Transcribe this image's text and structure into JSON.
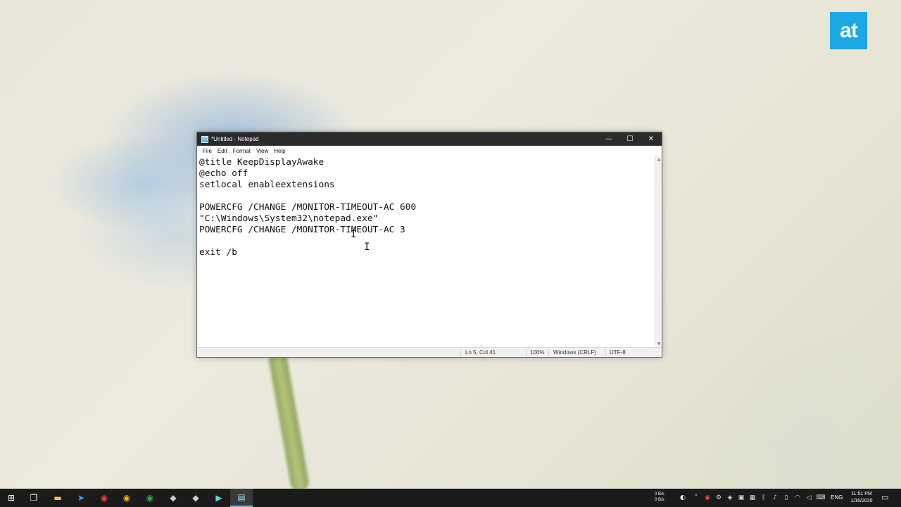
{
  "brand": {
    "logo_text": "at",
    "color": "#1ca8e4"
  },
  "notepad": {
    "title": "*Untitled - Notepad",
    "window_controls": {
      "minimize": "—",
      "maximize": "☐",
      "close": "✕"
    },
    "menu": [
      "File",
      "Edit",
      "Format",
      "View",
      "Help"
    ],
    "lines": [
      "@title KeepDisplayAwake",
      "@echo off",
      "setlocal enableextensions",
      "",
      "POWERCFG /CHANGE /MONITOR-TIMEOUT-AC 600",
      "\"C:\\Windows\\System32\\notepad.exe\"",
      "POWERCFG /CHANGE /MONITOR-TIMEOUT-AC 3",
      "",
      "exit /b"
    ],
    "status": {
      "position": "Ln 5, Col 41",
      "zoom": "100%",
      "line_ending": "Windows (CRLF)",
      "encoding": "UTF-8"
    }
  },
  "taskbar": {
    "pinned": [
      {
        "name": "start-icon",
        "glyph": "⊞"
      },
      {
        "name": "task-view-icon",
        "glyph": "❐"
      },
      {
        "name": "file-explorer-icon",
        "glyph": "▬"
      },
      {
        "name": "app-icon",
        "glyph": "➤"
      },
      {
        "name": "chrome-icon",
        "glyph": "◉"
      },
      {
        "name": "chrome-icon",
        "glyph": "◉"
      },
      {
        "name": "chrome-icon",
        "glyph": "◉"
      },
      {
        "name": "app-icon",
        "glyph": "◆"
      },
      {
        "name": "app-icon",
        "glyph": "◆"
      },
      {
        "name": "terminal-icon",
        "glyph": "▶"
      },
      {
        "name": "notepad-icon",
        "glyph": "▤"
      }
    ],
    "net_up": "0 B/s",
    "net_down": "0 B/s",
    "tray": [
      {
        "name": "moon-icon",
        "glyph": "◐"
      },
      {
        "name": "chevron-up-icon",
        "glyph": "˄"
      },
      {
        "name": "record-icon",
        "glyph": "◉"
      },
      {
        "name": "gear-icon",
        "glyph": "⚙"
      },
      {
        "name": "dropbox-icon",
        "glyph": "◈"
      },
      {
        "name": "folder-icon",
        "glyph": "▣"
      },
      {
        "name": "app-icon",
        "glyph": "▦"
      },
      {
        "name": "bluetooth-icon",
        "glyph": "ᛒ"
      },
      {
        "name": "microphone-icon",
        "glyph": "♪"
      },
      {
        "name": "battery-icon",
        "glyph": "▯"
      },
      {
        "name": "wifi-icon",
        "glyph": "◠"
      },
      {
        "name": "speaker-icon",
        "glyph": "◁"
      },
      {
        "name": "keyboard-icon",
        "glyph": "⌨"
      }
    ],
    "language": "ENG",
    "time": "11:51 PM",
    "date": "1/16/2020",
    "notification_glyph": "▭"
  }
}
